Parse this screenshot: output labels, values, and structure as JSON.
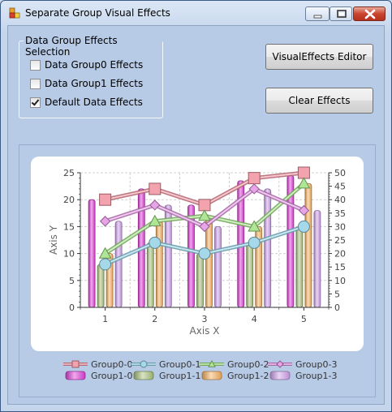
{
  "window": {
    "title": "Separate Group Visual Effects"
  },
  "groupbox": {
    "title": "Data Group Effects Selection",
    "options": [
      {
        "label": "Data Group0 Effects",
        "checked": false
      },
      {
        "label": "Data Group1 Effects",
        "checked": false
      },
      {
        "label": "Default Data Effects",
        "checked": true
      }
    ]
  },
  "buttons": {
    "editor": "VisualEffects Editor",
    "clear": "Clear Effects"
  },
  "chart_data": {
    "type": "bar",
    "xlabel": "Axis X",
    "ylabel": "Axis Y",
    "x": [
      1,
      2,
      3,
      4,
      5
    ],
    "y_left": {
      "range": [
        0,
        25
      ],
      "ticks": [
        0,
        5,
        10,
        15,
        20,
        25
      ]
    },
    "y_right": {
      "range": [
        0,
        50
      ],
      "ticks": [
        0,
        5,
        10,
        15,
        20,
        25,
        30,
        35,
        40,
        45,
        50
      ]
    },
    "grid": true,
    "legend_position": "bottom",
    "line_series": [
      {
        "name": "Group0-0",
        "values": [
          20,
          22,
          19,
          24,
          25
        ],
        "color": "#f08c9a",
        "marker": "square"
      },
      {
        "name": "Group0-1",
        "values": [
          8,
          12,
          10,
          12,
          15
        ],
        "color": "#8fd0e4",
        "marker": "circle"
      },
      {
        "name": "Group0-2",
        "values": [
          10,
          16,
          17,
          15,
          23
        ],
        "color": "#9be07c",
        "marker": "triangle"
      },
      {
        "name": "Group0-3",
        "values": [
          16,
          19,
          15,
          22,
          18
        ],
        "color": "#e08ee0",
        "marker": "diamond"
      }
    ],
    "bar_series": [
      {
        "name": "Group1-0",
        "values": [
          40,
          44,
          38,
          47,
          49
        ],
        "color": "#e040d8"
      },
      {
        "name": "Group1-1",
        "values": [
          16,
          24,
          20,
          24,
          30
        ],
        "color": "#a8c07a"
      },
      {
        "name": "Group1-2",
        "values": [
          20,
          32,
          34,
          30,
          46
        ],
        "color": "#f5b060"
      },
      {
        "name": "Group1-3",
        "values": [
          32,
          38,
          30,
          44,
          36
        ],
        "color": "#cfa0ea"
      }
    ]
  }
}
